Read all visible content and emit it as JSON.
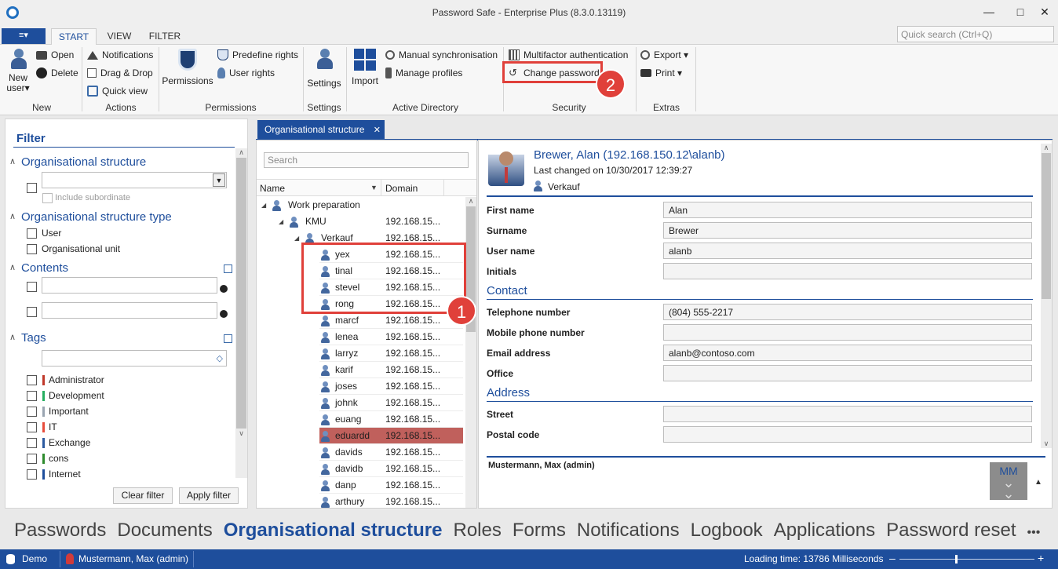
{
  "window": {
    "title": "Password Safe - Enterprise Plus (8.3.0.13119)",
    "minimize": "—",
    "maximize": "□",
    "close": "✕"
  },
  "menu": {
    "file_icon": "≡▾",
    "tabs": [
      "START",
      "VIEW",
      "FILTER"
    ],
    "active_tab": "START",
    "quick_search_placeholder": "Quick search (Ctrl+Q)"
  },
  "ribbon": {
    "new": {
      "new_user_line1": "New",
      "new_user_line2": "user▾",
      "open": "Open",
      "delete": "Delete",
      "group": "New"
    },
    "actions": {
      "notifications": "Notifications",
      "drag_drop": "Drag & Drop",
      "quick_view": "Quick view",
      "group": "Actions"
    },
    "permissions": {
      "permissions": "Permissions",
      "predefine_rights": "Predefine rights",
      "user_rights": "User rights",
      "group": "Permissions"
    },
    "settings": {
      "settings": "Settings",
      "group": "Settings"
    },
    "active_directory": {
      "import": "Import",
      "manual_sync": "Manual synchronisation",
      "manage_profiles": "Manage profiles",
      "group": "Active Directory"
    },
    "security": {
      "mfa": "Multifactor authentication",
      "change_password": "Change password",
      "group": "Security"
    },
    "extras": {
      "export": "Export ▾",
      "print": "Print ▾",
      "group": "Extras"
    }
  },
  "badges": {
    "one": "1",
    "two": "2"
  },
  "filter": {
    "title": "Filter",
    "org_structure": "Organisational structure",
    "include_subordinate": "Include subordinate",
    "org_structure_type": "Organisational structure type",
    "types": [
      "User",
      "Organisational unit"
    ],
    "contents": "Contents",
    "tags_title": "Tags",
    "tags": [
      {
        "name": "Administrator",
        "color": "#c0392b"
      },
      {
        "name": "Development",
        "color": "#27ae60"
      },
      {
        "name": "Important",
        "color": "#9aa5b1"
      },
      {
        "name": "IT",
        "color": "#e74c3c"
      },
      {
        "name": "Exchange",
        "color": "#2c5aa0"
      },
      {
        "name": "cons",
        "color": "#2e8b2e"
      },
      {
        "name": "Internet",
        "color": "#1e4e9c"
      }
    ],
    "clear_filter": "Clear filter",
    "apply_filter": "Apply filter"
  },
  "tree": {
    "tab_label": "Organisational structure",
    "tab_close": "✕",
    "search_placeholder": "Search",
    "col_name": "Name",
    "col_domain": "Domain",
    "nodes": [
      {
        "name": "Work preparation",
        "domain": "",
        "level": 0,
        "type": "org"
      },
      {
        "name": "KMU",
        "domain": "192.168.15...",
        "level": 1,
        "type": "org"
      },
      {
        "name": "Verkauf",
        "domain": "192.168.15...",
        "level": 2,
        "type": "org"
      },
      {
        "name": "yex",
        "domain": "192.168.15...",
        "level": 3,
        "type": "user"
      },
      {
        "name": "tinal",
        "domain": "192.168.15...",
        "level": 3,
        "type": "user"
      },
      {
        "name": "stevel",
        "domain": "192.168.15...",
        "level": 3,
        "type": "user"
      },
      {
        "name": "rong",
        "domain": "192.168.15...",
        "level": 3,
        "type": "user"
      },
      {
        "name": "marcf",
        "domain": "192.168.15...",
        "level": 3,
        "type": "user"
      },
      {
        "name": "lenea",
        "domain": "192.168.15...",
        "level": 3,
        "type": "user"
      },
      {
        "name": "larryz",
        "domain": "192.168.15...",
        "level": 3,
        "type": "user"
      },
      {
        "name": "karif",
        "domain": "192.168.15...",
        "level": 3,
        "type": "user"
      },
      {
        "name": "joses",
        "domain": "192.168.15...",
        "level": 3,
        "type": "user"
      },
      {
        "name": "johnk",
        "domain": "192.168.15...",
        "level": 3,
        "type": "user"
      },
      {
        "name": "euang",
        "domain": "192.168.15...",
        "level": 3,
        "type": "user"
      },
      {
        "name": "eduardd",
        "domain": "192.168.15...",
        "level": 3,
        "type": "user",
        "selected": true
      },
      {
        "name": "davids",
        "domain": "192.168.15...",
        "level": 3,
        "type": "user"
      },
      {
        "name": "davidb",
        "domain": "192.168.15...",
        "level": 3,
        "type": "user"
      },
      {
        "name": "danp",
        "domain": "192.168.15...",
        "level": 3,
        "type": "user"
      },
      {
        "name": "arthury",
        "domain": "192.168.15...",
        "level": 3,
        "type": "user"
      }
    ]
  },
  "detail": {
    "name": "Brewer, Alan (192.168.150.12\\alanb)",
    "last_changed": "Last changed on 10/30/2017 12:39:27",
    "department": "Verkauf",
    "fields": [
      {
        "label": "First name",
        "value": "Alan"
      },
      {
        "label": "Surname",
        "value": "Brewer"
      },
      {
        "label": "User name",
        "value": "alanb"
      },
      {
        "label": "Initials",
        "value": ""
      }
    ],
    "contact_title": "Contact",
    "contact": [
      {
        "label": "Telephone number",
        "value": "(804) 555-2217"
      },
      {
        "label": "Mobile phone number",
        "value": ""
      },
      {
        "label": "Email address",
        "value": "alanb@contoso.com"
      },
      {
        "label": "Office",
        "value": ""
      }
    ],
    "address_title": "Address",
    "address": [
      {
        "label": "Street",
        "value": ""
      },
      {
        "label": "Postal code",
        "value": ""
      }
    ],
    "footer_user": "Mustermann, Max (admin)",
    "footer_initials": "MM"
  },
  "nav": {
    "items": [
      "Passwords",
      "Documents",
      "Organisational structure",
      "Roles",
      "Forms",
      "Notifications",
      "Logbook",
      "Applications",
      "Password reset"
    ],
    "selected": "Organisational structure",
    "more": "•••"
  },
  "status": {
    "db": "Demo",
    "user": "Mustermann, Max (admin)",
    "loading": "Loading time: 13786 Milliseconds",
    "zoom_minus": "–",
    "zoom_plus": "+"
  }
}
